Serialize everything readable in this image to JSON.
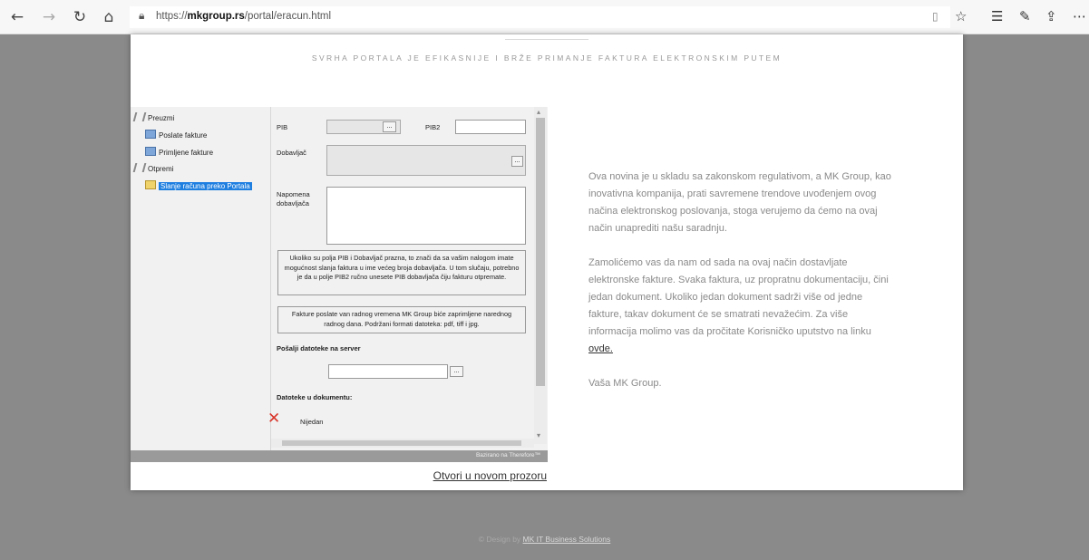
{
  "browser": {
    "url_prefix": "https://",
    "url_domain": "mkgroup.rs",
    "url_path": "/portal/eracun.html"
  },
  "header": {
    "tagline": "SVRHA PORTALA JE EFIKASNIJE I BRŽE PRIMANJE FAKTURA ELEKTRONSKIM PUTEM"
  },
  "tree": {
    "group1": "Preuzmi",
    "item1": "Poslate fakture",
    "item2": "Primljene fakture",
    "group2": "Otpremi",
    "item3": "Slanje računa preko Portala"
  },
  "form": {
    "pib_label": "PIB",
    "pib2_label": "PIB2",
    "dobavljac_label": "Dobavljač",
    "napomena_label_1": "Napomena",
    "napomena_label_2": "dobavljača",
    "browse_label": "...",
    "info1": "Ukoliko su polja PIB i Dobavljač prazna, to znači da sa vašim nalogom imate mogućnost slanja faktura u ime većeg broja dobavljača. U tom slučaju, potrebno je da u polje PIB2 ručno unesete PIB dobavljača čiju fakturu otpremate.",
    "info2": "Fakture poslate van radnog vremena MK Group biće zaprimljene narednog radnog dana. Podržani formati datoteka: pdf, tiff i jpg.",
    "upload_section": "Pošalji datoteke na server",
    "docs_section": "Datoteke u dokumentu:",
    "none_label": "Nijedan",
    "powered": "Bazirano na Therefore™",
    "open_new": "Otvori u novom prozoru"
  },
  "content": {
    "p1": "Ova novina je u skladu sa zakonskom regulativom, a MK Group, kao inovativna kompanija, prati savremene trendove uvođenjem ovog načina elektronskog poslovanja, stoga verujemo da ćemo na ovaj način unaprediti našu saradnju.",
    "p2": "Zamolićemo vas da nam od sada na ovaj način dostavljate elektronske fakture. Svaka faktura, uz propratnu dokumentaciju, čini jedan dokument. Ukoliko jedan dokument sadrži više od jedne fakture, takav dokument će se smatrati nevažećim. Za više informacija molimo vas da pročitate Korisničko uputstvo na linku",
    "link": "ovde.",
    "p3": "Vaša MK Group."
  },
  "footer": {
    "prefix": "© Design by ",
    "link": "MK IT Business Solutions"
  },
  "icons": {
    "back": "back-arrow-icon",
    "forward": "forward-arrow-icon",
    "refresh": "refresh-icon",
    "home": "home-icon"
  }
}
